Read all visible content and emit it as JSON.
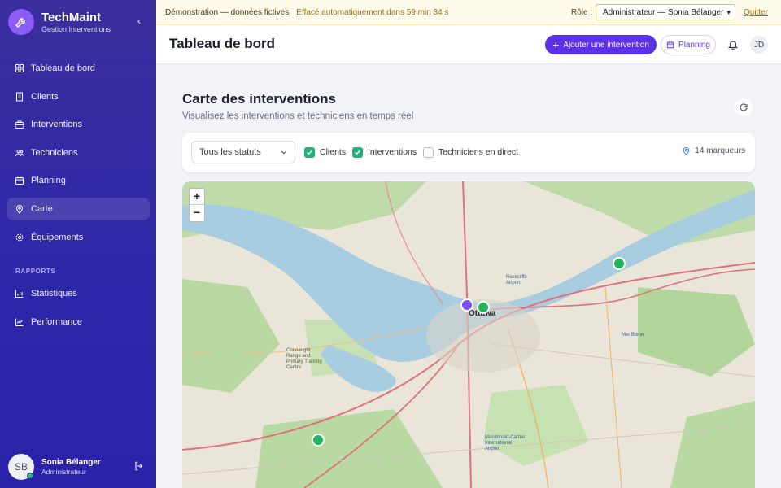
{
  "brand": {
    "name": "TechMaint",
    "subtitle": "Gestion Interventions"
  },
  "sidebar": {
    "items": [
      {
        "label": "Tableau de bord",
        "icon": "grid-icon"
      },
      {
        "label": "Clients",
        "icon": "building-icon"
      },
      {
        "label": "Interventions",
        "icon": "briefcase-icon"
      },
      {
        "label": "Techniciens",
        "icon": "users-icon"
      },
      {
        "label": "Planning",
        "icon": "calendar-icon"
      },
      {
        "label": "Carte",
        "icon": "map-pin-icon",
        "active": true
      },
      {
        "label": "Équipements",
        "icon": "gear-icon"
      }
    ],
    "section_label": "RAPPORTS",
    "report_items": [
      {
        "label": "Statistiques",
        "icon": "bar-chart-icon"
      },
      {
        "label": "Performance",
        "icon": "trend-icon"
      }
    ]
  },
  "user": {
    "initials": "SB",
    "name": "Sonia Bélanger",
    "role": "Administrateur"
  },
  "banner": {
    "title": "Démonstration — données fictives",
    "timer": "Effacé automatiquement dans 59 min 34 s",
    "role_label": "Rôle :",
    "role_value": "Administrateur — Sonia Bélanger",
    "quit": "Quitter"
  },
  "header": {
    "title": "Tableau de bord",
    "add_button": "Ajouter une intervention",
    "planning_button": "Planning",
    "avatar": "JD"
  },
  "main": {
    "title": "Carte des interventions",
    "subtitle": "Visualisez les interventions et techniciens en temps réel"
  },
  "filters": {
    "status_select": "Tous les statuts",
    "checks": [
      {
        "label": "Clients",
        "checked": true
      },
      {
        "label": "Interventions",
        "checked": true
      },
      {
        "label": "Techniciens en direct",
        "checked": false
      }
    ],
    "markers_count": "14 marqueurs"
  },
  "map": {
    "zoom_in": "+",
    "zoom_out": "−",
    "labels": {
      "city": "Ottawa",
      "airport": "Macdonald-Cartier International Airport",
      "area": "Connaught Range and Primary Training Centre",
      "east": "Mer Bleue",
      "north": "Rockcliffe Airport"
    },
    "colors": {
      "water": "#a9cde0",
      "forest": "#b7d9a0",
      "road": "#e0727a",
      "marker_client": "#22b45a",
      "marker_tech": "#7c4dff"
    }
  },
  "colors": {
    "accent": "#5b30e6",
    "sidebar": "#2e27a8",
    "check": "#22b07a"
  }
}
